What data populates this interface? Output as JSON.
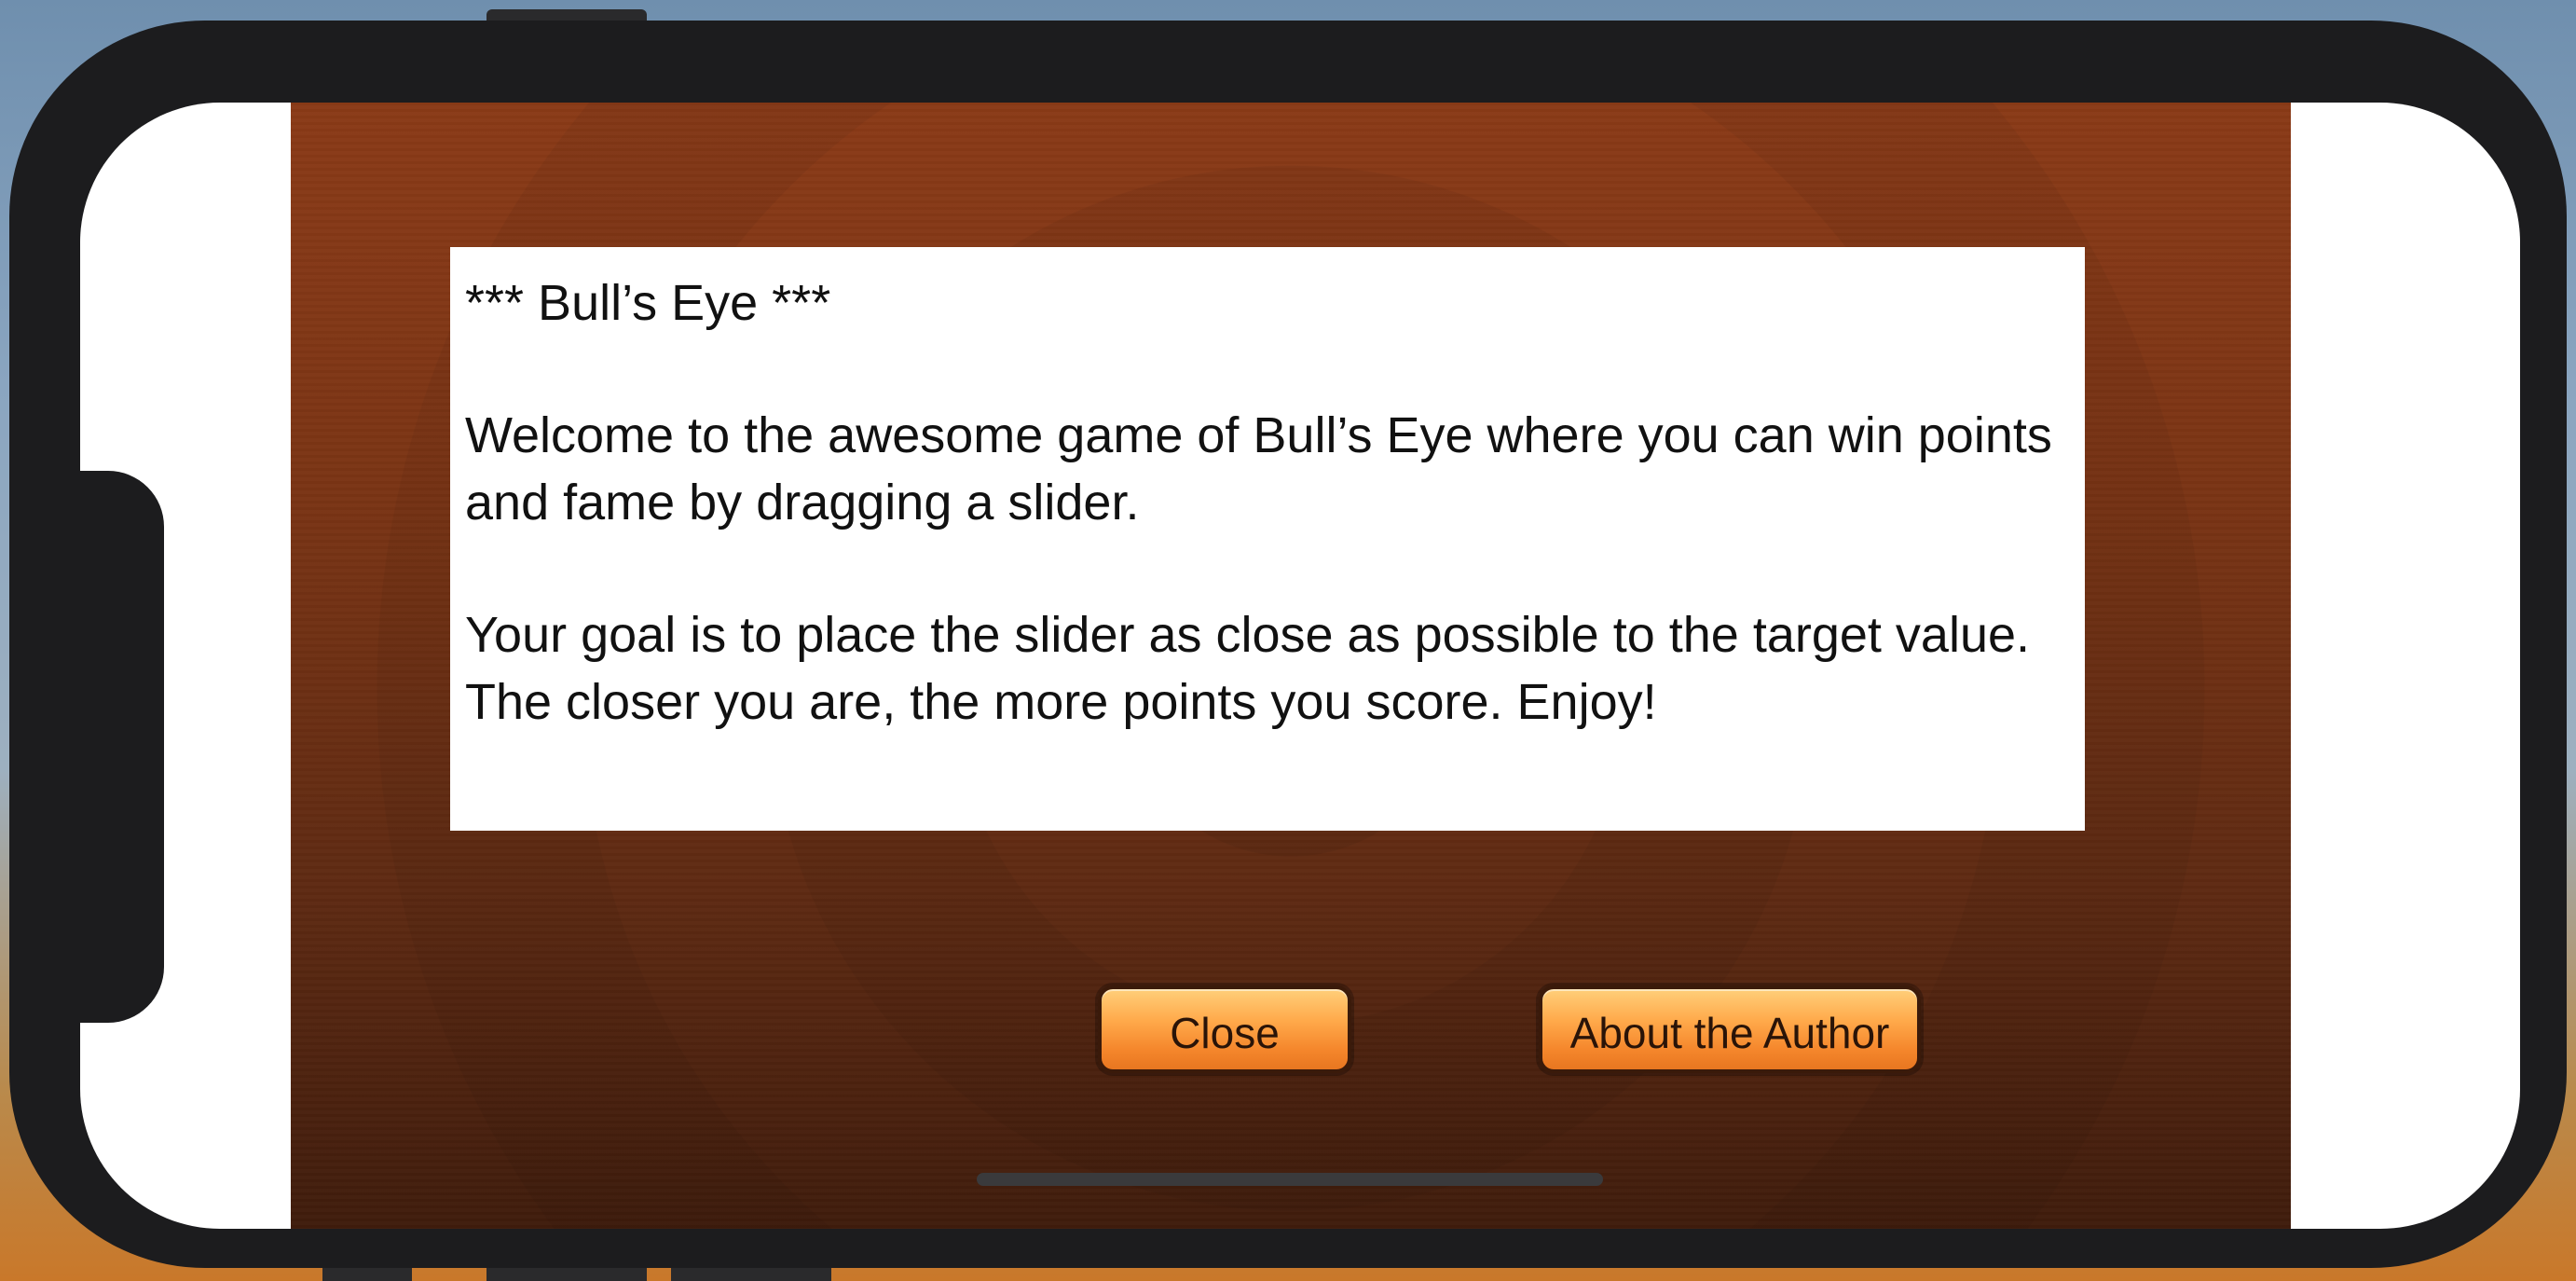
{
  "about_screen": {
    "title": "*** Bull’s Eye ***",
    "paragraph_1": "Welcome to the awesome game of Bull’s Eye where you can win points and fame by dragging a slider.",
    "paragraph_2": "Your goal is to place the slider as close as possible to the target value. The closer you are, the more points you score. Enjoy!"
  },
  "buttons": {
    "close_label": "Close",
    "about_author_label": "About the Author"
  },
  "colors": {
    "background_wood": "#7a3414",
    "button_orange": "#f5872c",
    "device_frame": "#1c1c1e"
  }
}
